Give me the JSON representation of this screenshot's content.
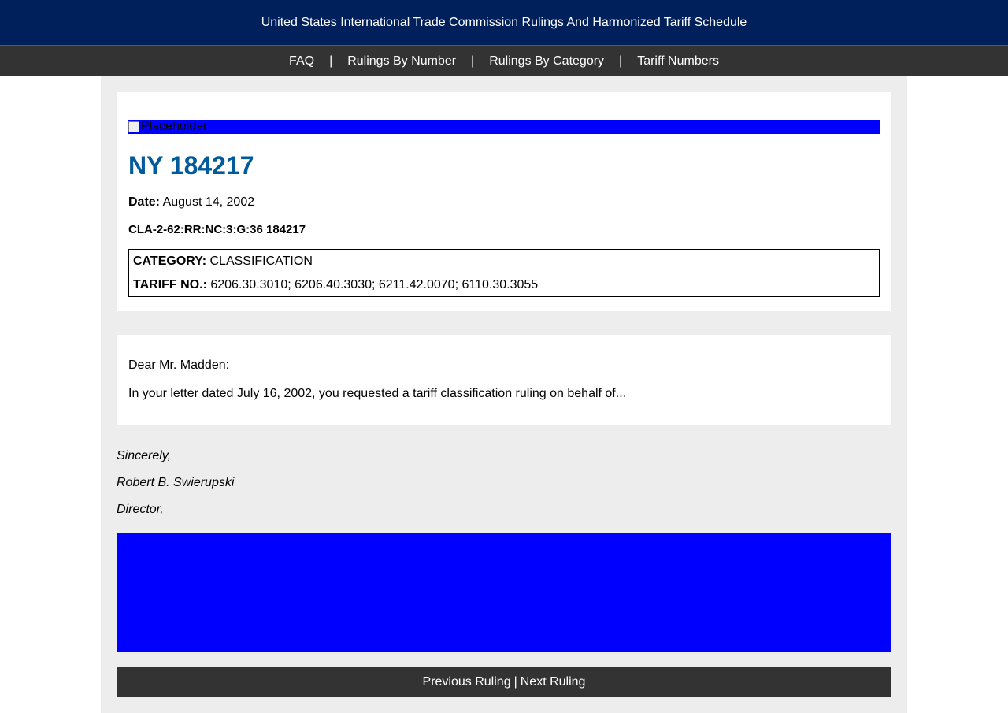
{
  "header": {
    "title": "United States International Trade Commission Rulings And Harmonized Tariff Schedule"
  },
  "nav": {
    "items": [
      "FAQ",
      "Rulings By Number",
      "Rulings By Category",
      "Tariff Numbers"
    ],
    "separator": "|"
  },
  "ruling": {
    "image_alt": "Placeholder",
    "number": "NY 184217",
    "date_label": "Date:",
    "date_value": "August 14, 2002",
    "reference": "CLA-2-62:RR:NC:3:G:36 184217",
    "category_label": "CATEGORY:",
    "category_value": "CLASSIFICATION",
    "tariff_label": "TARIFF NO.:",
    "tariff_value": "6206.30.3010; 6206.40.3030; 6211.42.0070; 6110.30.3055"
  },
  "letter": {
    "salutation": "Dear Mr. Madden:",
    "excerpt": "In your letter dated July 16, 2002, you requested a tariff classification ruling on behalf of..."
  },
  "signature": {
    "closing": "Sincerely,",
    "name": "Robert B. Swierupski",
    "title": "Director,"
  },
  "footer": {
    "previous": "Previous Ruling",
    "separator": "|",
    "next": "Next Ruling"
  },
  "colors": {
    "header_bg": "#00205b",
    "nav_bg": "#333333",
    "title": "#005a9c",
    "placeholder": "#0000ff"
  }
}
